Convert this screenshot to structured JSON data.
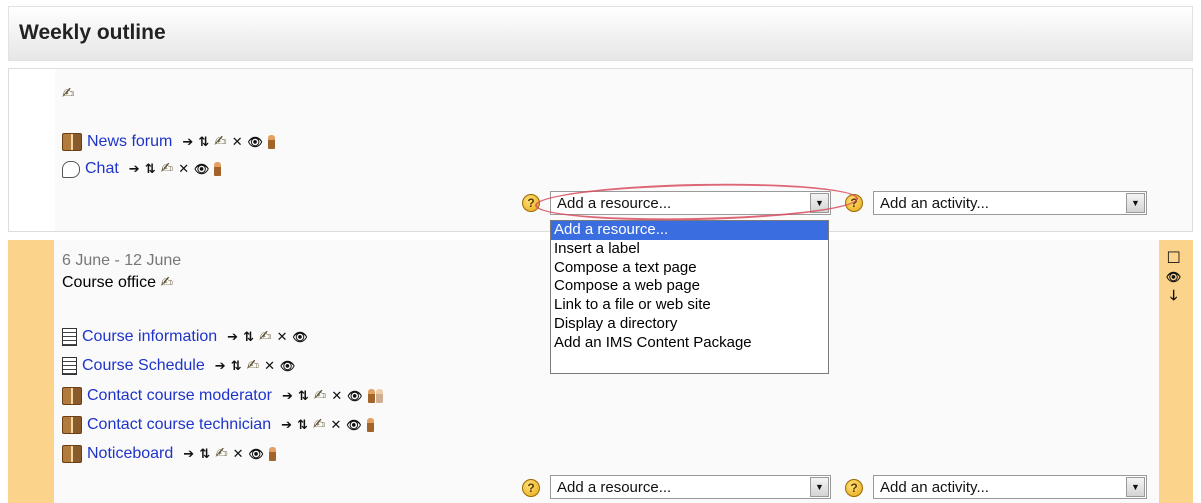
{
  "header": {
    "title": "Weekly outline"
  },
  "section0": {
    "activities": [
      {
        "icon": "forum-icon",
        "label": "News forum",
        "has_person": true
      },
      {
        "icon": "chat-icon",
        "label": "Chat",
        "has_person": true
      }
    ],
    "add_resource": {
      "selected": "Add a resource...",
      "options": [
        "Add a resource...",
        "Insert a label",
        "Compose a text page",
        "Compose a web page",
        "Link to a file or web site",
        "Display a directory",
        "Add an IMS Content Package"
      ]
    },
    "add_activity": {
      "selected": "Add an activity..."
    }
  },
  "section1": {
    "date": "6 June - 12 June",
    "summary": "Course office",
    "activities": [
      {
        "icon": "resource-icon",
        "label": "Course information"
      },
      {
        "icon": "resource-icon",
        "label": "Course Schedule"
      },
      {
        "icon": "forum-icon",
        "label": "Contact course moderator"
      },
      {
        "icon": "forum-icon",
        "label": "Contact course technician"
      },
      {
        "icon": "forum-icon",
        "label": "Noticeboard"
      }
    ],
    "add_resource": {
      "selected": "Add a resource..."
    },
    "add_activity": {
      "selected": "Add an activity..."
    }
  },
  "icons": {
    "move": "➔",
    "move_updown": "⇅",
    "edit": "✍",
    "delete": "✕",
    "show": "👁",
    "help": "?",
    "dropdown_arrow": "▼",
    "highlight": "☐",
    "move_down": "🡓"
  },
  "colors": {
    "link": "#1e34c8",
    "current_week_side": "#fcd38a",
    "selected_option": "#3a6ee0",
    "annotation": "#d84c5f"
  }
}
